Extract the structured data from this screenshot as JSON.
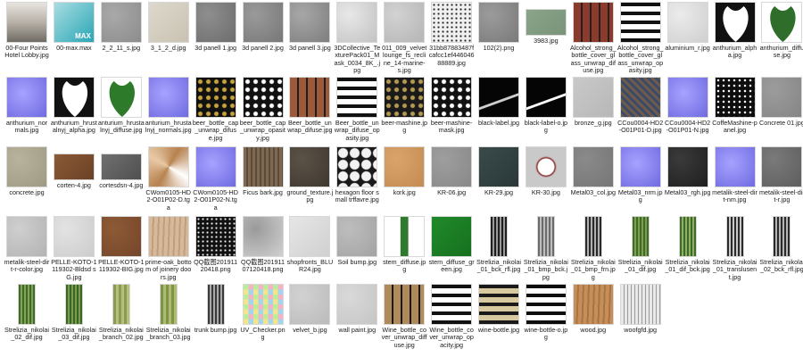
{
  "files": [
    {
      "name": "00-Four Points Hotel Lobby.jpg",
      "icon": "lobby-photo",
      "c1": "#b7b1a8",
      "c2": "#6f6a63",
      "v": "photo"
    },
    {
      "name": "00-max.max",
      "icon": "3dsmax-file-icon",
      "c1": "#2aa6b4",
      "c2": "#a8dde3",
      "v": "max"
    },
    {
      "name": "2_2_11_s.jpg",
      "icon": "texture-thumbnail",
      "c1": "#a9a9a9",
      "c2": "#8c8c8c",
      "v": "noise"
    },
    {
      "name": "3_1_2_d.jpg",
      "icon": "texture-thumbnail",
      "c1": "#ddd8cc",
      "c2": "#c9c2b2",
      "v": "plain"
    },
    {
      "name": "3d panell 1.jpg",
      "icon": "texture-thumbnail",
      "c1": "#8e8e8e",
      "c2": "#6d6d6d",
      "v": "noise"
    },
    {
      "name": "3d panell 2.jpg",
      "icon": "texture-thumbnail",
      "c1": "#9a9a9a",
      "c2": "#777777",
      "v": "noise"
    },
    {
      "name": "3d panell 3.jpg",
      "icon": "texture-thumbnail",
      "c1": "#a7a7a7",
      "c2": "#7e7e7e",
      "v": "noise"
    },
    {
      "name": "3DCollective_TexturePack01_Mask_0034_8K_.jpg",
      "icon": "texture-thumbnail",
      "c1": "#e8e8e8",
      "c2": "#c2c2c2",
      "v": "noise"
    },
    {
      "name": "011_009_velvet lounge_fs_recline_14-marine-s.jpg",
      "icon": "texture-thumbnail",
      "c1": "#d2d2d2",
      "c2": "#b5b5b5",
      "v": "noise"
    },
    {
      "name": "31bb87883487fcafcc1ef44604688889.jpg",
      "icon": "texture-thumbnail",
      "c1": "#f0f0f0",
      "c2": "#222222",
      "v": "speckle"
    },
    {
      "name": "102(2).png",
      "icon": "texture-thumbnail",
      "c1": "#9b9b9b",
      "c2": "#7a7a7a",
      "v": "noise"
    },
    {
      "name": "3983.jpg",
      "icon": "texture-thumbnail",
      "c1": "#8aa58a",
      "c2": "#7a937a",
      "v": "wide"
    },
    {
      "name": "Alcohol_strong_bottle_cover_glass_unwrap_difuse.jpg",
      "icon": "texture-thumbnail",
      "c1": "#222222",
      "c2": "#8b3a2b",
      "v": "labels"
    },
    {
      "name": "Alcohol_strong_bottle_cover_glass_unwrap_opasity.jpg",
      "icon": "texture-thumbnail",
      "c1": "#111111",
      "c2": "#ffffff",
      "v": "blocks"
    },
    {
      "name": "aluminium_r.jpg",
      "icon": "texture-thumbnail",
      "c1": "#ebebeb",
      "c2": "#cfcfcf",
      "v": "noise"
    },
    {
      "name": "anthurium_alpha.jpg",
      "icon": "texture-thumbnail",
      "c1": "#111111",
      "c2": "#ffffff",
      "v": "leafmask"
    },
    {
      "name": "anthurium_diffuse.jpg",
      "icon": "texture-thumbnail",
      "c1": "#ffffff",
      "c2": "#2f6d2a",
      "v": "leaf"
    },
    {
      "name": "anthurium_normals.jpg",
      "icon": "texture-thumbnail",
      "c1": "#8a86f0",
      "c2": "#6f6ae0",
      "v": "normal"
    },
    {
      "name": "anthurium_hrustalnyj_alpha.jpg",
      "icon": "texture-thumbnail",
      "c1": "#111111",
      "c2": "#ffffff",
      "v": "leafmask"
    },
    {
      "name": "anturium_hrustalnyj_diffuse.jpg",
      "icon": "texture-thumbnail",
      "c1": "#ffffff",
      "c2": "#2c7a2a",
      "v": "leaf"
    },
    {
      "name": "anturium_hrustalnyj_normals.jpg",
      "icon": "texture-thumbnail",
      "c1": "#8a86f0",
      "c2": "#6f6ae0",
      "v": "normal"
    },
    {
      "name": "beer_bottle_cap_unwrap_difuse.jpg",
      "icon": "texture-thumbnail",
      "c1": "#111111",
      "c2": "#c8a23a",
      "v": "caps"
    },
    {
      "name": "beer_bottle_cap_unwrap_opasity.jpg",
      "icon": "texture-thumbnail",
      "c1": "#111111",
      "c2": "#ffffff",
      "v": "caps"
    },
    {
      "name": "Beer_bottle_unwrap_difuse.jpg",
      "icon": "texture-thumbnail",
      "c1": "#1e1e1e",
      "c2": "#9c5a3a",
      "v": "labels"
    },
    {
      "name": "Beer_bottle_unwrap_difuse_opasity.jpg",
      "icon": "texture-thumbnail",
      "c1": "#111111",
      "c2": "#ffffff",
      "v": "blocks"
    },
    {
      "name": "beer-mashine.jpg",
      "icon": "texture-thumbnail",
      "c1": "#1a1a1a",
      "c2": "#b59a52",
      "v": "caps"
    },
    {
      "name": "beer-mashine-mask.jpg",
      "icon": "texture-thumbnail",
      "c1": "#111111",
      "c2": "#ffffff",
      "v": "caps"
    },
    {
      "name": "black-label.jpg",
      "icon": "texture-thumbnail",
      "c1": "#050505",
      "c2": "#cfcfcf",
      "v": "label"
    },
    {
      "name": "black-label-o.jpg",
      "icon": "texture-thumbnail",
      "c1": "#050505",
      "c2": "#ffffff",
      "v": "label"
    },
    {
      "name": "bronze_g.jpg",
      "icon": "texture-thumbnail",
      "c1": "#c9c9c9",
      "c2": "#b7b7b7",
      "v": "plain"
    },
    {
      "name": "CCou0004-HD2-O01P01-D.jpg",
      "icon": "texture-thumbnail",
      "c1": "#6e5a4a",
      "c2": "#3a4a6a",
      "v": "fabric"
    },
    {
      "name": "CCou0004-HD2-O01P01-N.jpg",
      "icon": "texture-thumbnail",
      "c1": "#8a86f0",
      "c2": "#6f6ae0",
      "v": "normal"
    },
    {
      "name": "CoffeMashine-panel.jpg",
      "icon": "texture-thumbnail",
      "c1": "#0d0d0d",
      "c2": "#ffffff",
      "v": "dots"
    },
    {
      "name": "Concrete 01.jpg",
      "icon": "texture-thumbnail",
      "c1": "#9c9c9c",
      "c2": "#858585",
      "v": "noise"
    },
    {
      "name": "concrete.jpg",
      "icon": "texture-thumbnail",
      "c1": "#b8b39c",
      "c2": "#9f9a83",
      "v": "noise"
    },
    {
      "name": "corten-4.jpg",
      "icon": "texture-thumbnail",
      "c1": "#8b5a36",
      "c2": "#6b4226",
      "v": "wide"
    },
    {
      "name": "cortesdsn-4.jpg",
      "icon": "texture-thumbnail",
      "c1": "#707070",
      "c2": "#4f4f4f",
      "v": "wide"
    },
    {
      "name": "CWom0105-HD2-O01P02-D.tga",
      "icon": "texture-thumbnail",
      "c1": "#ffffff",
      "c2": "#b7824f",
      "v": "shards"
    },
    {
      "name": "CWom0105-HD2-O01P02-N.tga",
      "icon": "texture-thumbnail",
      "c1": "#8a86f0",
      "c2": "#6f6ae0",
      "v": "normal"
    },
    {
      "name": "Ficus bark.jpg",
      "icon": "texture-thumbnail",
      "c1": "#7e6a52",
      "c2": "#5c4b38",
      "v": "bark"
    },
    {
      "name": "ground_texture.jpg",
      "icon": "texture-thumbnail",
      "c1": "#5b5247",
      "c2": "#3f3830",
      "v": "noise"
    },
    {
      "name": "hexagon floor small trffavre.jpg",
      "icon": "texture-thumbnail",
      "c1": "#1a1a1a",
      "c2": "#f2f2f2",
      "v": "hex"
    },
    {
      "name": "kork.jpg",
      "icon": "texture-thumbnail",
      "c1": "#d9a46a",
      "c2": "#c48b52",
      "v": "noise"
    },
    {
      "name": "KR-06.jpg",
      "icon": "texture-thumbnail",
      "c1": "#9e9e9e",
      "c2": "#888888",
      "v": "noise"
    },
    {
      "name": "KR-29.jpg",
      "icon": "texture-thumbnail",
      "c1": "#3a4a4a",
      "c2": "#2a3838",
      "v": "plate"
    },
    {
      "name": "KR-30.jpg",
      "icon": "texture-thumbnail",
      "c1": "#dedede",
      "c2": "#8a2a2a",
      "v": "gauge"
    },
    {
      "name": "Metal03_col.jpg",
      "icon": "texture-thumbnail",
      "c1": "#8a8a8a",
      "c2": "#767676",
      "v": "noise"
    },
    {
      "name": "Metal03_nrm.jpg",
      "icon": "texture-thumbnail",
      "c1": "#8a86f0",
      "c2": "#6f6ae0",
      "v": "normal"
    },
    {
      "name": "Metal03_rgh.jpg",
      "icon": "texture-thumbnail",
      "c1": "#3a3a3a",
      "c2": "#1f1f1f",
      "v": "noise"
    },
    {
      "name": "metalik-steel-dirt-nm.jpg",
      "icon": "texture-thumbnail",
      "c1": "#8a86f0",
      "c2": "#6f6ae0",
      "v": "normal"
    },
    {
      "name": "metalik-steel-dirt-r.jpg",
      "icon": "texture-thumbnail",
      "c1": "#7a7a7a",
      "c2": "#5e5e5e",
      "v": "noise"
    },
    {
      "name": "metalik-steel-dirt-r-color.jpg",
      "icon": "texture-thumbnail",
      "c1": "#cfcfcf",
      "c2": "#b3b3b3",
      "v": "noise"
    },
    {
      "name": "PELLE-KOTO-1119302-Bldsd sG.jpg",
      "icon": "texture-thumbnail",
      "c1": "#e3e3e3",
      "c2": "#cccccc",
      "v": "noise"
    },
    {
      "name": "PELLE-KOTO-1119302-BIG.jpg",
      "icon": "texture-thumbnail",
      "c1": "#8e5a36",
      "c2": "#74462a",
      "v": "noise"
    },
    {
      "name": "prime-oak_bottom of joinery doors.jpg",
      "icon": "texture-thumbnail",
      "c1": "#d5b99a",
      "c2": "#bf9f7d",
      "v": "wood"
    },
    {
      "name": "QQ截图20191120418.png",
      "icon": "texture-thumbnail",
      "c1": "#111111",
      "c2": "#eeeeee",
      "v": "speckle"
    },
    {
      "name": "QQ截图20191107120418.png",
      "icon": "texture-thumbnail",
      "c1": "#9a9a9a",
      "c2": "#d0d0d0",
      "v": "noise"
    },
    {
      "name": "shopfronts_BLUR24.jpg",
      "icon": "texture-thumbnail",
      "c1": "#e6e6e6",
      "c2": "#d0d0d0",
      "v": "plain"
    },
    {
      "name": "Soil bump.jpg",
      "icon": "texture-thumbnail",
      "c1": "#bdbdbd",
      "c2": "#a3a3a3",
      "v": "noise"
    },
    {
      "name": "stem_diffuse.jpg",
      "icon": "texture-thumbnail",
      "c1": "#ffffff",
      "c2": "#2f7a2f",
      "v": "stem"
    },
    {
      "name": "stem_diffuse_green.jpg",
      "icon": "texture-thumbnail",
      "c1": "#1f8a2a",
      "c2": "#17701f",
      "v": "plain"
    },
    {
      "name": "Strelizia_nikolai_01_bck_rfl.jpg",
      "icon": "texture-thumbnail",
      "c1": "#1e1e1e",
      "c2": "#9a9a9a",
      "v": "strip"
    },
    {
      "name": "Strelizia_nikolai_01_bmp_bck.jpg",
      "icon": "texture-thumbnail",
      "c1": "#6b6b6b",
      "c2": "#bdbdbd",
      "v": "strip"
    },
    {
      "name": "Strelizia_nikolai_01_bmp_frn.jpg",
      "icon": "texture-thumbnail",
      "c1": "#2a2a2a",
      "c2": "#b0b0b0",
      "v": "strip"
    },
    {
      "name": "Strelizia_nikolai_01_dif.jpg",
      "icon": "texture-thumbnail",
      "c1": "#3f6a2a",
      "c2": "#7ea04a",
      "v": "strip"
    },
    {
      "name": "Strelizia_nikolai_01_dif_bck.jpg",
      "icon": "texture-thumbnail",
      "c1": "#3d6a2c",
      "c2": "#8eb060",
      "v": "strip"
    },
    {
      "name": "Strelizia_nikolai_01_translusent.jpg",
      "icon": "texture-thumbnail",
      "c1": "#2a2a2a",
      "c2": "#c8c8c8",
      "v": "strip"
    },
    {
      "name": "Strelizia_nikolai_02_bck_rfl.jpg",
      "icon": "texture-thumbnail",
      "c1": "#2a2a2a",
      "c2": "#b5b5b5",
      "v": "strip"
    },
    {
      "name": "Strelizia_nikolai_02_dif.jpg",
      "icon": "texture-thumbnail",
      "c1": "#3f6a2a",
      "c2": "#82a454",
      "v": "strip"
    },
    {
      "name": "Strelizia_nikolai_03_dif.jpg",
      "icon": "texture-thumbnail",
      "c1": "#3a6528",
      "c2": "#7c9e4c",
      "v": "strip"
    },
    {
      "name": "Strelizia_nikolai_branch_02.jpg",
      "icon": "texture-thumbnail",
      "c1": "#8a9a52",
      "c2": "#b6c07a",
      "v": "branch"
    },
    {
      "name": "Strelizia_nikolai_branch_03.jpg",
      "icon": "texture-thumbnail",
      "c1": "#7e9448",
      "c2": "#b0bb72",
      "v": "branch"
    },
    {
      "name": "trunk bump.jpg",
      "icon": "texture-thumbnail",
      "c1": "#3a3a3a",
      "c2": "#a8a8a8",
      "v": "strip"
    },
    {
      "name": "UV_Checker.png",
      "icon": "texture-thumbnail",
      "c1": "#f5b3c8",
      "c2": "#9fd6f2",
      "v": "checker"
    },
    {
      "name": "velvet_b.jpg",
      "icon": "texture-thumbnail",
      "c1": "#d2d2d2",
      "c2": "#bbbbbb",
      "v": "noise"
    },
    {
      "name": "wall paint.jpg",
      "icon": "texture-thumbnail",
      "c1": "#d9d9d9",
      "c2": "#c5c5c5",
      "v": "noise"
    },
    {
      "name": "Wine_bottle_cover_unwrap_diffuse.jpg",
      "icon": "texture-thumbnail",
      "c1": "#1a1a1a",
      "c2": "#b08a5a",
      "v": "labels"
    },
    {
      "name": "Wine_bottle_cover_unwrap_opacity.jpg",
      "icon": "texture-thumbnail",
      "c1": "#111111",
      "c2": "#ffffff",
      "v": "blocks"
    },
    {
      "name": "wine-bottle.jpg",
      "icon": "texture-thumbnail",
      "c1": "#1a1a1a",
      "c2": "#d8c9a0",
      "v": "blocks"
    },
    {
      "name": "wine-bottle-o.jpg",
      "icon": "texture-thumbnail",
      "c1": "#0d0d0d",
      "c2": "#ffffff",
      "v": "blocks"
    },
    {
      "name": "wood.jpg",
      "icon": "texture-thumbnail",
      "c1": "#c58e5a",
      "c2": "#a8743f",
      "v": "wood"
    },
    {
      "name": "woofgfd.jpg",
      "icon": "texture-thumbnail",
      "c1": "#e8e8e8",
      "c2": "#9a9a9a",
      "v": "woodgrey"
    }
  ]
}
